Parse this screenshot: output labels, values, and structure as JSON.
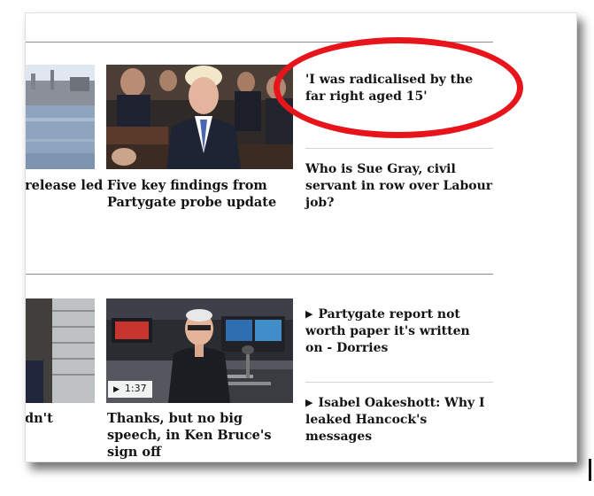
{
  "top_row": {
    "partial_left": {
      "headline": "release led"
    },
    "story": {
      "headline": "Five key findings from Partygate probe update"
    },
    "aside": [
      {
        "text": "'I was radicalised by the far right aged 15'"
      },
      {
        "text": "Who is Sue Gray, civil servant in row over Labour job?"
      }
    ]
  },
  "bottom_row": {
    "partial_left": {
      "headline": "dn't"
    },
    "story": {
      "headline": "Thanks, but no big speech, in Ken Bruce's sign off",
      "video_duration": "1:37"
    },
    "aside": [
      {
        "text": "Partygate report not worth paper it's written on - Dorries"
      },
      {
        "text": "Isabel Oakeshott: Why I leaked Hancock's messages"
      }
    ]
  },
  "colors": {
    "highlight_circle": "#e8141b"
  },
  "icons": {
    "video": "play-icon"
  }
}
